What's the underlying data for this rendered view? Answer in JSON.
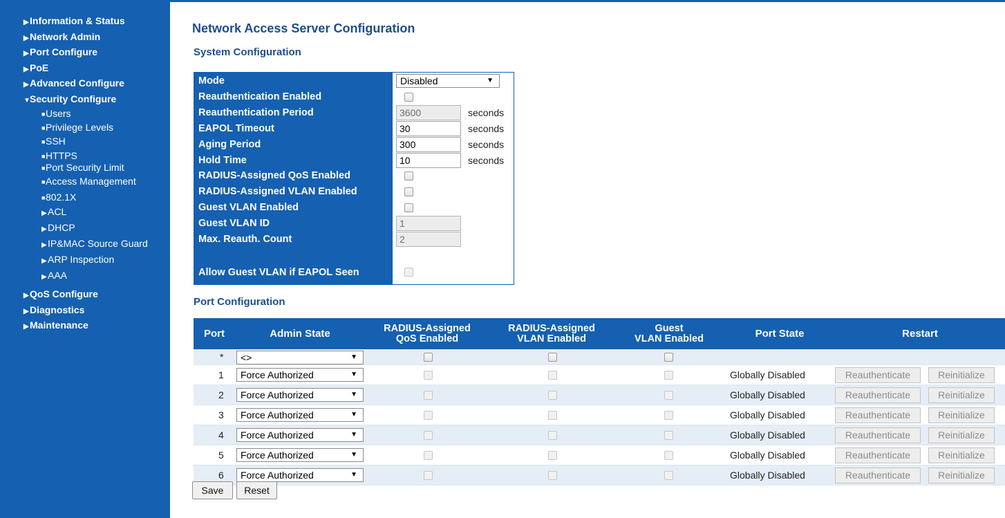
{
  "header": {
    "accent_color": "#1560b0"
  },
  "sidebar": {
    "items": [
      {
        "label": "Information & Status"
      },
      {
        "label": "Network Admin"
      },
      {
        "label": "Port Configure"
      },
      {
        "label": "PoE"
      },
      {
        "label": "Advanced Configure"
      },
      {
        "label": "Security Configure",
        "expanded": true
      },
      {
        "label": "QoS Configure"
      },
      {
        "label": "Diagnostics"
      },
      {
        "label": "Maintenance"
      }
    ],
    "security_subitems": [
      {
        "label": "Users"
      },
      {
        "label": "Privilege Levels"
      },
      {
        "label": "SSH"
      },
      {
        "label": "HTTPS"
      },
      {
        "label": "Port Security Limit"
      },
      {
        "label": "Access Management"
      },
      {
        "label": "802.1X"
      },
      {
        "label": "ACL"
      },
      {
        "label": "DHCP"
      },
      {
        "label": "IP&MAC Source Guard"
      },
      {
        "label": "ARP Inspection"
      },
      {
        "label": "AAA"
      }
    ]
  },
  "main": {
    "title": "Network Access Server Configuration",
    "system_title": "System Configuration",
    "port_title": "Port Configuration"
  },
  "system_config": {
    "mode": {
      "label": "Mode",
      "value": "Disabled"
    },
    "reauth_enabled": {
      "label": "Reauthentication Enabled",
      "checked": false
    },
    "reauth_period": {
      "label": "Reauthentication Period",
      "value": "3600",
      "unit": "seconds"
    },
    "eapol_timeout": {
      "label": "EAPOL Timeout",
      "value": "30",
      "unit": "seconds"
    },
    "aging_period": {
      "label": "Aging Period",
      "value": "300",
      "unit": "seconds"
    },
    "hold_time": {
      "label": "Hold Time",
      "value": "10",
      "unit": "seconds"
    },
    "radius_qos": {
      "label": "RADIUS-Assigned QoS Enabled",
      "checked": false
    },
    "radius_vlan": {
      "label": "RADIUS-Assigned VLAN Enabled",
      "checked": false
    },
    "guest_vlan_enabled": {
      "label": "Guest VLAN Enabled",
      "checked": false
    },
    "guest_vlan_id": {
      "label": "Guest VLAN ID",
      "value": "1"
    },
    "max_reauth": {
      "label": "Max. Reauth. Count",
      "value": "2"
    },
    "allow_guest": {
      "label": "Allow Guest VLAN if EAPOL Seen",
      "checked": false
    }
  },
  "port_config": {
    "headers": {
      "port": "Port",
      "admin_state": "Admin State",
      "radius_qos_1": "RADIUS-Assigned",
      "radius_qos_2": "QoS Enabled",
      "radius_vlan_1": "RADIUS-Assigned",
      "radius_vlan_2": "VLAN Enabled",
      "guest_vlan_1": "Guest",
      "guest_vlan_2": "VLAN Enabled",
      "port_state": "Port State",
      "restart": "Restart"
    },
    "star_row": {
      "port": "*",
      "admin_state": "<>"
    },
    "rows": [
      {
        "port": "1",
        "admin_state": "Force Authorized",
        "port_state": "Globally Disabled"
      },
      {
        "port": "2",
        "admin_state": "Force Authorized",
        "port_state": "Globally Disabled"
      },
      {
        "port": "3",
        "admin_state": "Force Authorized",
        "port_state": "Globally Disabled"
      },
      {
        "port": "4",
        "admin_state": "Force Authorized",
        "port_state": "Globally Disabled"
      },
      {
        "port": "5",
        "admin_state": "Force Authorized",
        "port_state": "Globally Disabled"
      },
      {
        "port": "6",
        "admin_state": "Force Authorized",
        "port_state": "Globally Disabled"
      }
    ],
    "reauth_label": "Reauthenticate",
    "reinit_label": "Reinitialize"
  },
  "actions": {
    "save_label": "Save",
    "reset_label": "Reset"
  }
}
